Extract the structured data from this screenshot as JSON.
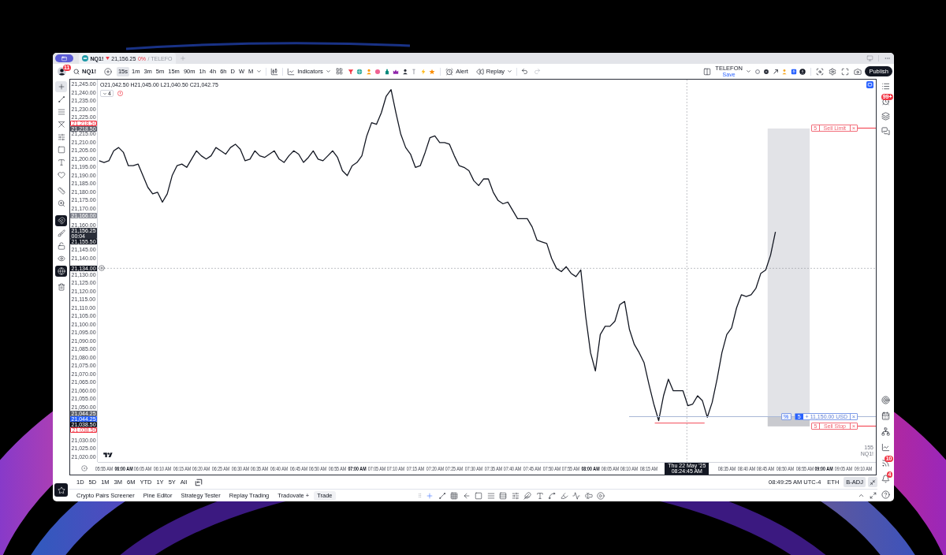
{
  "tab_strip": {
    "tabs": [
      {
        "symbol": "NQ1!",
        "price_down": true,
        "price": "21,156.25",
        "change": "0%",
        "layout": "/ TELEFO",
        "selected": true
      }
    ]
  },
  "toolbar": {
    "notifications": "11",
    "symbol": "NQ1!",
    "intervals": [
      {
        "label": "15s",
        "selected": true
      },
      {
        "label": "1m",
        "selected": false
      },
      {
        "label": "3m",
        "selected": false
      },
      {
        "label": "5m",
        "selected": false
      },
      {
        "label": "15m",
        "selected": false
      },
      {
        "label": "90m",
        "selected": false
      },
      {
        "label": "1h",
        "selected": false
      },
      {
        "label": "4h",
        "selected": false
      },
      {
        "label": "6h",
        "selected": false
      },
      {
        "label": "D",
        "selected": false
      },
      {
        "label": "W",
        "selected": false
      },
      {
        "label": "M",
        "selected": false
      }
    ],
    "indicators": "Indicators",
    "alert": "Alert",
    "replay": "Replay",
    "layout_name": "TELEFON",
    "save_status": "Save",
    "publish": "Publish"
  },
  "left_toolbar": {
    "drawing_tools": [
      {
        "kind": "crosshair",
        "selected": true
      },
      {
        "kind": "trend-line",
        "selected": false
      },
      {
        "kind": "fib",
        "selected": false
      },
      {
        "kind": "pattern",
        "selected": false
      },
      {
        "kind": "forecast",
        "selected": false
      },
      {
        "kind": "rectangle",
        "selected": false
      },
      {
        "kind": "text",
        "selected": false
      },
      {
        "kind": "heart",
        "selected": false
      },
      {
        "kind": "ruler",
        "selected": false
      },
      {
        "kind": "zoom",
        "selected": false
      }
    ],
    "toggles": [
      {
        "kind": "magnet",
        "on": true
      },
      {
        "kind": "brush",
        "on": false
      },
      {
        "kind": "lock",
        "on": false
      },
      {
        "kind": "eye",
        "on": false
      },
      {
        "kind": "globe",
        "on": true
      }
    ],
    "favorites": {
      "on": true
    }
  },
  "chart": {
    "legend": {
      "ohlc": "O21,042.50 H21,045.00 L21,040.50 C21,042.75",
      "hidden_count": "4"
    },
    "price_labels": [
      {
        "kind": "order",
        "label": "21,218.50",
        "color": "#f23645"
      },
      {
        "kind": "marker",
        "label": "21,218.50",
        "color": "#5d606b"
      },
      {
        "kind": "marker",
        "label": "21,166.00",
        "color": "#868993"
      },
      {
        "kind": "marker",
        "label": "21,156.25",
        "countdown": "00:04",
        "color": "#2a2e39"
      },
      {
        "kind": "marker",
        "label": "21,155.50",
        "color": "#131722"
      },
      {
        "kind": "marker",
        "label": "21,044.25",
        "color": "#5d606b"
      },
      {
        "kind": "marker",
        "label": "21,044.25",
        "color": "#2962ff"
      },
      {
        "kind": "marker",
        "label": "21,038.50",
        "color": "#131722"
      },
      {
        "kind": "order",
        "label": "21,038.50",
        "color": "#f23645"
      }
    ],
    "crosshair": {
      "price": "21,134.00",
      "time": "Thu 22 May '25 08:24:45 AM"
    },
    "orders": [
      {
        "kind": "order",
        "qty": "5",
        "label": "Sell Limit",
        "close": "×"
      },
      {
        "kind": "position",
        "unit": "%",
        "qty": "5",
        "label": "+ 11,150.00 USD",
        "close": "×"
      },
      {
        "kind": "order",
        "qty": "5",
        "label": "Sell Stop",
        "close": "×"
      }
    ],
    "corner_labels": [
      "155",
      "NQ1!"
    ],
    "chart_data": {
      "type": "line",
      "x": [
        353.75,
        355,
        356.25,
        357.5,
        358.75,
        360,
        361.25,
        362.5,
        363.75,
        365,
        366.25,
        367.5,
        368.75,
        370,
        371.25,
        372.5,
        373.75,
        375,
        376.25,
        377.5,
        378.75,
        380,
        381.25,
        382.5,
        383.75,
        385,
        386.25,
        387.5,
        388.75,
        390,
        391.25,
        392.5,
        393.75,
        395,
        396.25,
        397.5,
        398.75,
        400,
        401.25,
        402.5,
        403.75,
        405,
        406.25,
        407.5,
        408.75,
        410,
        411.25,
        412.5,
        413.75,
        415,
        416.25,
        417.5,
        418.75,
        420,
        421.25,
        422.5,
        423.75,
        425,
        426.25,
        427.5,
        428.75,
        430,
        431.25,
        432.5,
        433.75,
        435,
        436.25,
        437.5,
        438.75,
        440,
        441.25,
        442.5,
        443.75,
        445,
        446.25,
        447.5,
        448.75,
        450,
        451.25,
        452.5,
        453.75,
        455,
        456.25,
        457.5,
        458.75,
        460,
        461.25,
        462.5,
        463.75,
        465,
        466.25,
        467.5,
        468.75,
        470,
        471.25,
        472.5,
        473.75,
        475,
        476.25,
        477.5,
        478.75,
        480,
        481.25,
        482.5,
        483.75,
        485,
        486.25,
        487.5,
        488.75,
        490,
        491.25,
        492.5,
        493.75,
        495,
        496.25,
        497.5,
        498.75,
        500,
        501.25,
        502.5,
        503.75,
        505,
        506.25,
        507.5,
        508.75,
        510,
        511.25,
        512.5,
        513.75,
        515,
        516.25,
        517.5,
        518.75,
        520,
        521.25,
        522.5,
        523.75,
        525,
        526.25,
        527.5
      ],
      "values": [
        21199,
        21198,
        21199,
        21205,
        21207,
        21204,
        21196,
        21196,
        21197,
        21190,
        21183,
        21179,
        21180,
        21174,
        21179,
        21190,
        21196,
        21197,
        21195,
        21200,
        21205,
        21202,
        21200,
        21202,
        21207,
        21205,
        21203,
        21207,
        21209,
        21206,
        21199,
        21200,
        21205,
        21202,
        21201,
        21203,
        21205,
        21200,
        21198,
        21202,
        21205,
        21203,
        21198,
        21201,
        21205,
        21200,
        21199,
        21202,
        21205,
        21201,
        21193,
        21190,
        21196,
        21198,
        21202,
        21214,
        21222,
        21221,
        21228,
        21238,
        21242,
        21228,
        21215,
        21207,
        21203,
        21195,
        21196,
        21204,
        21213,
        21214,
        21210,
        21210,
        21209,
        21202,
        21196,
        21195,
        21193,
        21187,
        21184,
        21188,
        21188,
        21180,
        21175,
        21173,
        21174,
        21169,
        21164,
        21164,
        21164,
        21159,
        21151,
        21150,
        21149,
        21140,
        21134,
        21132,
        21135,
        21131,
        21129,
        21133,
        21105,
        21083,
        21072,
        21094,
        21099,
        21099,
        21102,
        21112,
        21114,
        21097,
        21088,
        21083,
        21077,
        21064,
        21052,
        21042,
        21057,
        21067,
        21060,
        21060,
        21060,
        21051,
        21052,
        21057,
        21054,
        21044,
        21053,
        21067,
        21083,
        21094,
        21098,
        21110,
        21118,
        21117,
        21118,
        21122,
        21131,
        21133,
        21142,
        21156
      ],
      "xlim": [
        346.1,
        553.5
      ],
      "ylim": [
        21008.9,
        21248.5
      ],
      "xticks": [
        {
          "value": 355,
          "label": "05:55 AM"
        },
        {
          "value": 360,
          "label": "06:00 AM"
        },
        {
          "value": 365,
          "label": "06:05 AM"
        },
        {
          "value": 370,
          "label": "06:10 AM"
        },
        {
          "value": 375,
          "label": "06:15 AM"
        },
        {
          "value": 380,
          "label": "06:20 AM"
        },
        {
          "value": 385,
          "label": "06:25 AM"
        },
        {
          "value": 390,
          "label": "06:30 AM"
        },
        {
          "value": 395,
          "label": "06:35 AM"
        },
        {
          "value": 400,
          "label": "06:40 AM"
        },
        {
          "value": 405,
          "label": "06:45 AM"
        },
        {
          "value": 410,
          "label": "06:50 AM"
        },
        {
          "value": 415,
          "label": "06:55 AM"
        },
        {
          "value": 420,
          "label": "07:00 AM"
        },
        {
          "value": 425,
          "label": "07:05 AM"
        },
        {
          "value": 430,
          "label": "07:10 AM"
        },
        {
          "value": 435,
          "label": "07:15 AM"
        },
        {
          "value": 440,
          "label": "07:20 AM"
        },
        {
          "value": 445,
          "label": "07:25 AM"
        },
        {
          "value": 450,
          "label": "07:30 AM"
        },
        {
          "value": 455,
          "label": "07:35 AM"
        },
        {
          "value": 460,
          "label": "07:40 AM"
        },
        {
          "value": 465,
          "label": "07:45 AM"
        },
        {
          "value": 470,
          "label": "07:50 AM"
        },
        {
          "value": 475,
          "label": "07:55 AM"
        },
        {
          "value": 480,
          "label": "08:00 AM"
        },
        {
          "value": 485,
          "label": "08:05 AM"
        },
        {
          "value": 490,
          "label": "08:10 AM"
        },
        {
          "value": 495,
          "label": "08:15 AM"
        },
        {
          "value": 515,
          "label": "08:35 AM"
        },
        {
          "value": 520,
          "label": "08:40 AM"
        },
        {
          "value": 525,
          "label": "08:45 AM"
        },
        {
          "value": 530,
          "label": "08:50 AM"
        },
        {
          "value": 535,
          "label": "08:55 AM"
        },
        {
          "value": 540,
          "label": "09:00 AM"
        },
        {
          "value": 545,
          "label": "09:05 AM"
        },
        {
          "value": 550,
          "label": "09:10 AM"
        }
      ],
      "yticks": [
        {
          "value": 21245,
          "label": "21,245.00"
        },
        {
          "value": 21240,
          "label": "21,240.00"
        },
        {
          "value": 21235,
          "label": "21,235.00"
        },
        {
          "value": 21230,
          "label": "21,230.00"
        },
        {
          "value": 21225,
          "label": "21,225.00"
        },
        {
          "value": 21215,
          "label": "21,215.00"
        },
        {
          "value": 21210,
          "label": "21,210.00"
        },
        {
          "value": 21205,
          "label": "21,205.00"
        },
        {
          "value": 21200,
          "label": "21,200.00"
        },
        {
          "value": 21195,
          "label": "21,195.00"
        },
        {
          "value": 21190,
          "label": "21,190.00"
        },
        {
          "value": 21185,
          "label": "21,185.00"
        },
        {
          "value": 21180,
          "label": "21,180.00"
        },
        {
          "value": 21175,
          "label": "21,175.00"
        },
        {
          "value": 21170,
          "label": "21,170.00"
        },
        {
          "value": 21160,
          "label": "21,160.00"
        },
        {
          "value": 21145,
          "label": "21,145.00"
        },
        {
          "value": 21140,
          "label": "21,140.00"
        },
        {
          "value": 21130,
          "label": "21,130.00"
        },
        {
          "value": 21125,
          "label": "21,125.00"
        },
        {
          "value": 21120,
          "label": "21,120.00"
        },
        {
          "value": 21115,
          "label": "21,115.00"
        },
        {
          "value": 21110,
          "label": "21,110.00"
        },
        {
          "value": 21105,
          "label": "21,105.00"
        },
        {
          "value": 21100,
          "label": "21,100.00"
        },
        {
          "value": 21095,
          "label": "21,095.00"
        },
        {
          "value": 21090,
          "label": "21,090.00"
        },
        {
          "value": 21085,
          "label": "21,085.00"
        },
        {
          "value": 21080,
          "label": "21,080.00"
        },
        {
          "value": 21075,
          "label": "21,075.00"
        },
        {
          "value": 21070,
          "label": "21,070.00"
        },
        {
          "value": 21065,
          "label": "21,065.00"
        },
        {
          "value": 21060,
          "label": "21,060.00"
        },
        {
          "value": 21055,
          "label": "21,055.00"
        },
        {
          "value": 21050,
          "label": "21,050.00"
        },
        {
          "value": 21030,
          "label": "21,030.00"
        },
        {
          "value": 21025,
          "label": "21,025.00"
        },
        {
          "value": 21020,
          "label": "21,020.00"
        }
      ]
    }
  },
  "right_toolbar": {
    "alerts_badge": "99+",
    "news_badge": "10",
    "notifications_badge": "4"
  },
  "range_bar": {
    "ranges": [
      {
        "label": "1D",
        "selected": false
      },
      {
        "label": "5D",
        "selected": false
      },
      {
        "label": "1M",
        "selected": false
      },
      {
        "label": "3M",
        "selected": false
      },
      {
        "label": "6M",
        "selected": false
      },
      {
        "label": "YTD",
        "selected": false
      },
      {
        "label": "1Y",
        "selected": false
      },
      {
        "label": "5Y",
        "selected": false
      },
      {
        "label": "All",
        "selected": false
      }
    ],
    "clock": "08:49:25 AM UTC-4",
    "toggles": [
      {
        "label": "ETH",
        "on": false
      },
      {
        "label": "B-ADJ",
        "on": true
      }
    ]
  },
  "bottom_panel": {
    "tabs": [
      {
        "label": "Crypto Pairs Screener",
        "selected": false
      },
      {
        "label": "Pine Editor",
        "selected": false
      },
      {
        "label": "Strategy Tester",
        "selected": false
      },
      {
        "label": "Replay Trading",
        "selected": false
      },
      {
        "label": "Tradovate +",
        "selected": false
      }
    ],
    "trade": "Trade",
    "quick_tools": [
      {
        "kind": "crosshair",
        "selected": true
      },
      {
        "kind": "trend-line",
        "selected": false
      },
      {
        "kind": "grid",
        "selected": false
      },
      {
        "kind": "arrow-left",
        "selected": false
      },
      {
        "kind": "rectangle",
        "selected": false
      },
      {
        "kind": "lines-a",
        "selected": false
      },
      {
        "kind": "lines-b",
        "selected": false
      },
      {
        "kind": "lines-c",
        "selected": false
      },
      {
        "kind": "feather",
        "selected": false
      },
      {
        "kind": "text",
        "selected": false
      },
      {
        "kind": "curve",
        "selected": false
      },
      {
        "kind": "highlighter",
        "selected": false
      },
      {
        "kind": "zigzag",
        "selected": false
      },
      {
        "kind": "text-cursor",
        "selected": false
      },
      {
        "kind": "play",
        "selected": false
      }
    ]
  }
}
